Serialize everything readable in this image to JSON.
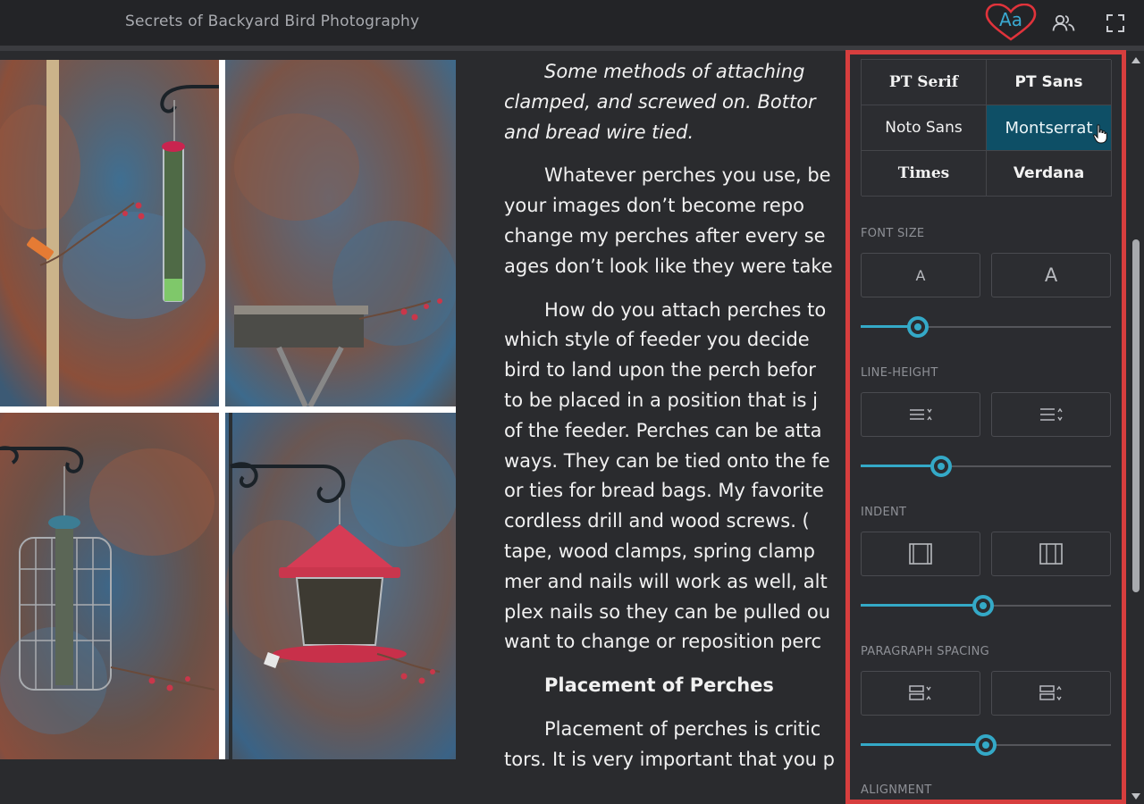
{
  "header": {
    "book_title": "Secrets of Backyard Bird Photography",
    "icons": [
      "text-settings-icon",
      "readers-icon",
      "fullscreen-icon"
    ],
    "aa_label": "Aa"
  },
  "reader": {
    "caption_lines": [
      "Some methods of attaching",
      "clamped, and screwed on. Bottor",
      "and bread wire tied."
    ],
    "paragraph1_lines": [
      "Whatever perches you use, be",
      "your images don’t become repo",
      "change my perches after every se",
      "ages don’t look like they were take"
    ],
    "paragraph2_lines": [
      "How do you attach perches to",
      "which style of feeder you decide",
      "bird to land upon the perch befor",
      "to be placed in a position that is j",
      "of the feeder. Perches can be atta",
      "ways. They can be tied onto the fe",
      "or ties for bread bags. My favorite",
      "cordless drill and wood screws. (",
      "tape, wood clamps, spring clamp",
      "mer and nails will work as well, alt",
      "plex nails so they can be pulled ou",
      "want to change or reposition perc"
    ],
    "heading": "Placement of Perches",
    "paragraph3_lines": [
      "Placement of perches is critic",
      "tors. It is very important that you p"
    ]
  },
  "settings": {
    "fonts": [
      {
        "label": "PT Serif",
        "style": "serif",
        "selected": false
      },
      {
        "label": "PT Sans",
        "style": "sans-bold",
        "selected": false
      },
      {
        "label": "Noto Sans",
        "style": "sans",
        "selected": false
      },
      {
        "label": "Montserrat",
        "style": "sans",
        "selected": true
      },
      {
        "label": "Times",
        "style": "serif",
        "selected": false
      },
      {
        "label": "Verdana",
        "style": "sans-bold",
        "selected": false
      }
    ],
    "font_size": {
      "label": "FONT SIZE",
      "decrease_label": "A",
      "increase_label": "A",
      "value": 0.23
    },
    "line_height": {
      "label": "LINE-HEIGHT",
      "value": 0.32
    },
    "indent": {
      "label": "INDENT",
      "value": 0.49
    },
    "paragraph_spacing": {
      "label": "PARAGRAPH SPACING",
      "value": 0.5
    },
    "alignment": {
      "label": "ALIGNMENT"
    },
    "accent_color": "#34a9c7",
    "selected_font_bg": "#0e4f66",
    "panel_border_color": "#d73e3e"
  },
  "scrollbar": {
    "position": 0.18
  }
}
